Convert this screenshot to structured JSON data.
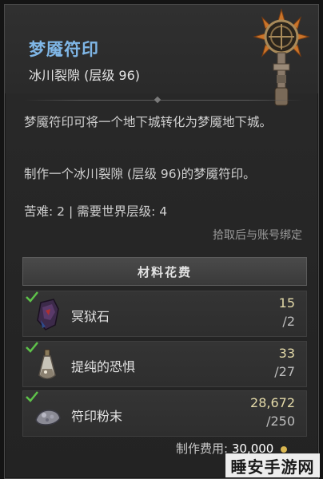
{
  "item": {
    "title": "梦魇符印",
    "subtitle": "冰川裂隙 (层级 96)",
    "description": "梦魇符印可将一个地下城转化为梦魇地下城。",
    "craft_text": "制作一个冰川裂隙 (层级 96)的梦魇符印。",
    "difficulty_text": "苦难: 2 | 需要世界层级: 4",
    "bind_text": "拾取后与账号绑定"
  },
  "materials": {
    "header": "材料花费",
    "items": [
      {
        "name": "冥狱石",
        "have": "15",
        "need": "/2",
        "icon": "dark-stone-icon"
      },
      {
        "name": "提纯的恐惧",
        "have": "33",
        "need": "/27",
        "icon": "fear-vial-icon"
      },
      {
        "name": "符印粉末",
        "have": "28,672",
        "need": "/250",
        "icon": "sigil-powder-icon"
      }
    ]
  },
  "cost": {
    "label": "制作费用:",
    "amount": "30,000",
    "icon": "gold-icon"
  },
  "watermark": "睡安手游网",
  "colors": {
    "title": "#7fb6e6",
    "check": "#5ec24a",
    "have": "#e3d9a8"
  }
}
